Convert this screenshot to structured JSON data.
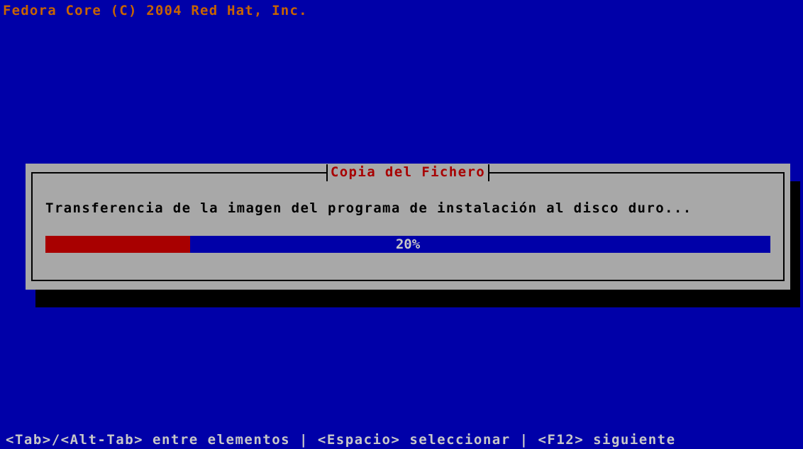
{
  "header": {
    "copyright": "Fedora Core (C) 2004 Red Hat, Inc."
  },
  "dialog": {
    "title": "Copia del Fichero",
    "message": "Transferencia de la imagen del programa de instalación al disco duro...",
    "progress": {
      "percent": 20,
      "label": "20%"
    }
  },
  "footer": {
    "help": "<Tab>/<Alt-Tab> entre elementos | <Espacio> seleccionar | <F12> siguiente"
  },
  "colors": {
    "background": "#0000a8",
    "dialog": "#a8a8a8",
    "title": "#a80000",
    "progress_fill": "#a80000",
    "header": "#c86400"
  }
}
